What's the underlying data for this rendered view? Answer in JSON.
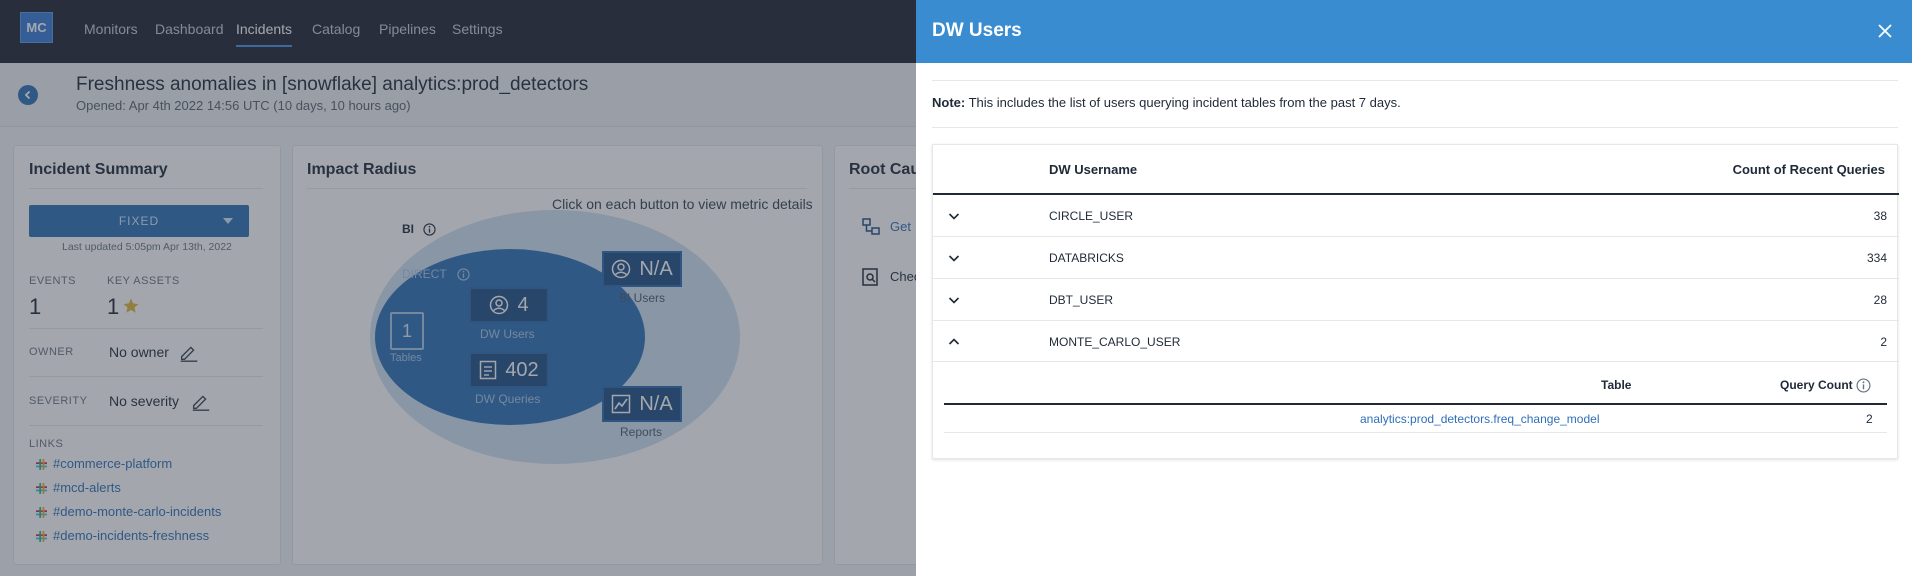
{
  "nav": {
    "logo": "MC",
    "items": [
      "Monitors",
      "Dashboard",
      "Incidents",
      "Catalog",
      "Pipelines",
      "Settings"
    ],
    "active": "Incidents"
  },
  "incident": {
    "title": "Freshness anomalies in [snowflake] analytics:prod_detectors",
    "opened": "Opened: Apr 4th 2022 14:56 UTC (10 days, 10 hours ago)"
  },
  "summary": {
    "title": "Incident Summary",
    "status": "FIXED",
    "last_updated": "Last updated 5:05pm Apr 13th, 2022",
    "events_label": "EVENTS",
    "events_value": "1",
    "key_assets_label": "KEY ASSETS",
    "key_assets_value": "1",
    "owner_label": "OWNER",
    "owner_value": "No owner",
    "severity_label": "SEVERITY",
    "severity_value": "No severity",
    "links_label": "LINKS",
    "links": [
      "#commerce-platform",
      "#mcd-alerts",
      "#demo-monte-carlo-incidents",
      "#demo-incidents-freshness"
    ]
  },
  "impact": {
    "title": "Impact Radius",
    "hint": "Click on each button to view metric details",
    "bi_label": "BI",
    "direct_label": "DIRECT",
    "tables_value": "1",
    "tables_label": "Tables",
    "dw_users_value": "4",
    "dw_users_label": "DW Users",
    "dw_queries_value": "402",
    "dw_queries_label": "DW Queries",
    "bi_users_value": "N/A",
    "bi_users_label": "BI Users",
    "reports_value": "N/A",
    "reports_label": "Reports"
  },
  "root_cause": {
    "title": "Root Caus",
    "item1": "Get",
    "item2": "Chec"
  },
  "drawer": {
    "title": "DW Users",
    "note_bold": "Note:",
    "note_text": " This includes the list of users querying incident tables from the past 7 days.",
    "col_username": "DW Username",
    "col_count": "Count of Recent Queries",
    "rows": [
      {
        "username": "CIRCLE_USER",
        "count": "38",
        "expanded": false
      },
      {
        "username": "DATABRICKS",
        "count": "334",
        "expanded": false
      },
      {
        "username": "DBT_USER",
        "count": "28",
        "expanded": false
      },
      {
        "username": "MONTE_CARLO_USER",
        "count": "2",
        "expanded": true
      }
    ],
    "sub_col_table": "Table",
    "sub_col_count": "Query Count",
    "sub_rows": [
      {
        "table": "analytics:prod_detectors.freq_change_model",
        "count": "2"
      }
    ]
  },
  "colors": {
    "nav_bg": "#1f2330",
    "drawer_header": "#3a8cd0",
    "accent": "#2f6fb7",
    "star": "#e0b43a"
  }
}
